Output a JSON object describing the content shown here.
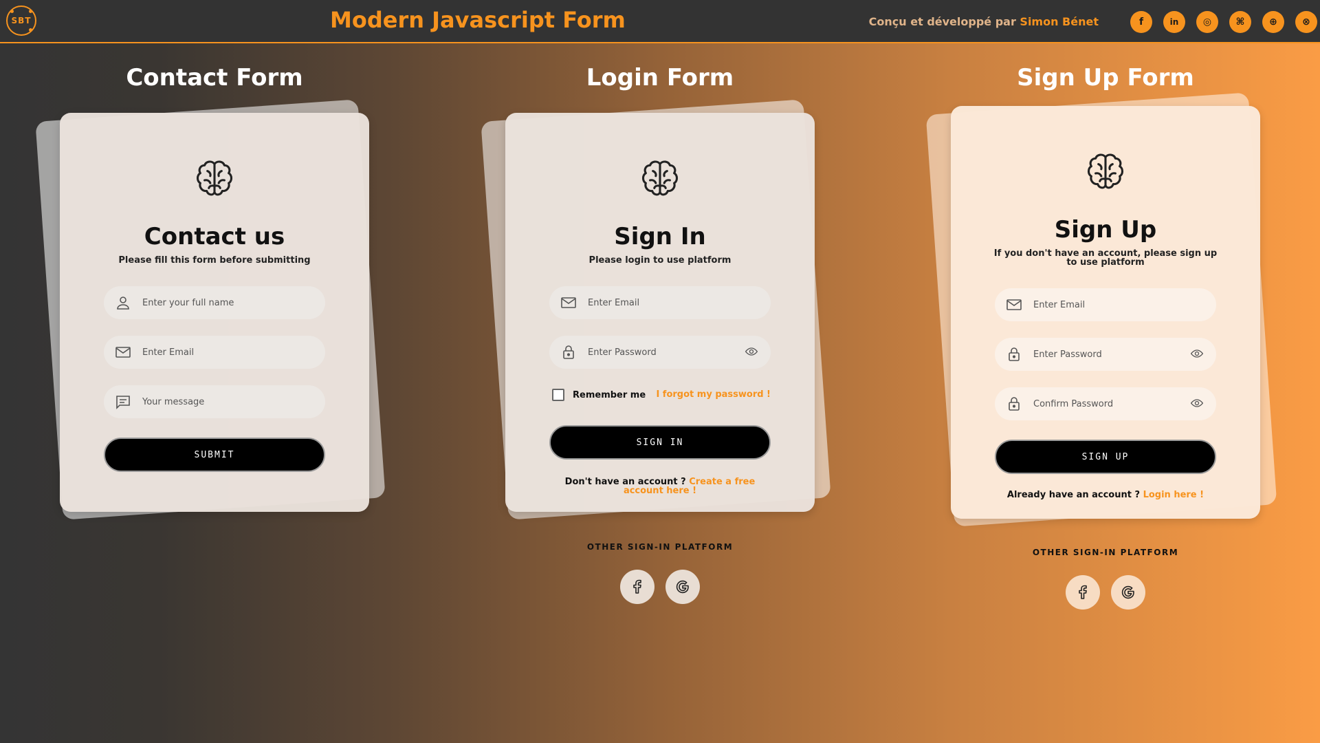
{
  "header": {
    "logo_text": "SBT",
    "title": "Modern Javascript Form",
    "credit_prefix": "Conçu et développé par ",
    "credit_author": "Simon Bénet",
    "socials": [
      {
        "name": "facebook",
        "glyph": "f"
      },
      {
        "name": "linkedin",
        "glyph": "in"
      },
      {
        "name": "instagram",
        "glyph": "◎"
      },
      {
        "name": "github",
        "glyph": "⌘"
      },
      {
        "name": "portfolio",
        "glyph": "⊕"
      },
      {
        "name": "website",
        "glyph": "⊗"
      }
    ]
  },
  "contact": {
    "column_title": "Contact Form",
    "heading": "Contact us",
    "subtitle": "Please fill this form before submitting",
    "name_placeholder": "Enter your full name",
    "email_placeholder": "Enter Email",
    "message_placeholder": "Your message",
    "submit_label": "SUBMIT"
  },
  "login": {
    "column_title": "Login Form",
    "heading": "Sign In",
    "subtitle": "Please login to use platform",
    "email_placeholder": "Enter Email",
    "password_placeholder": "Enter Password",
    "remember_label": "Remember me",
    "forgot_label": "I forgot my password !",
    "submit_label": "SIGN IN",
    "no_account_text": "Don't have an account ? ",
    "create_link": "Create a free account here !",
    "other_label": "OTHER SIGN-IN PLATFORM"
  },
  "signup": {
    "column_title": "Sign Up Form",
    "heading": "Sign Up",
    "subtitle": "If you don't have an account, please sign up to use platform",
    "email_placeholder": "Enter Email",
    "password_placeholder": "Enter Password",
    "confirm_placeholder": "Confirm Password",
    "submit_label": "SIGN UP",
    "have_account_text": "Already have an account ? ",
    "login_link": "Login here !",
    "other_label": "OTHER SIGN-IN PLATFORM"
  },
  "colors": {
    "accent": "#f7931e",
    "header_bg": "#333333",
    "button_bg": "#000000"
  }
}
